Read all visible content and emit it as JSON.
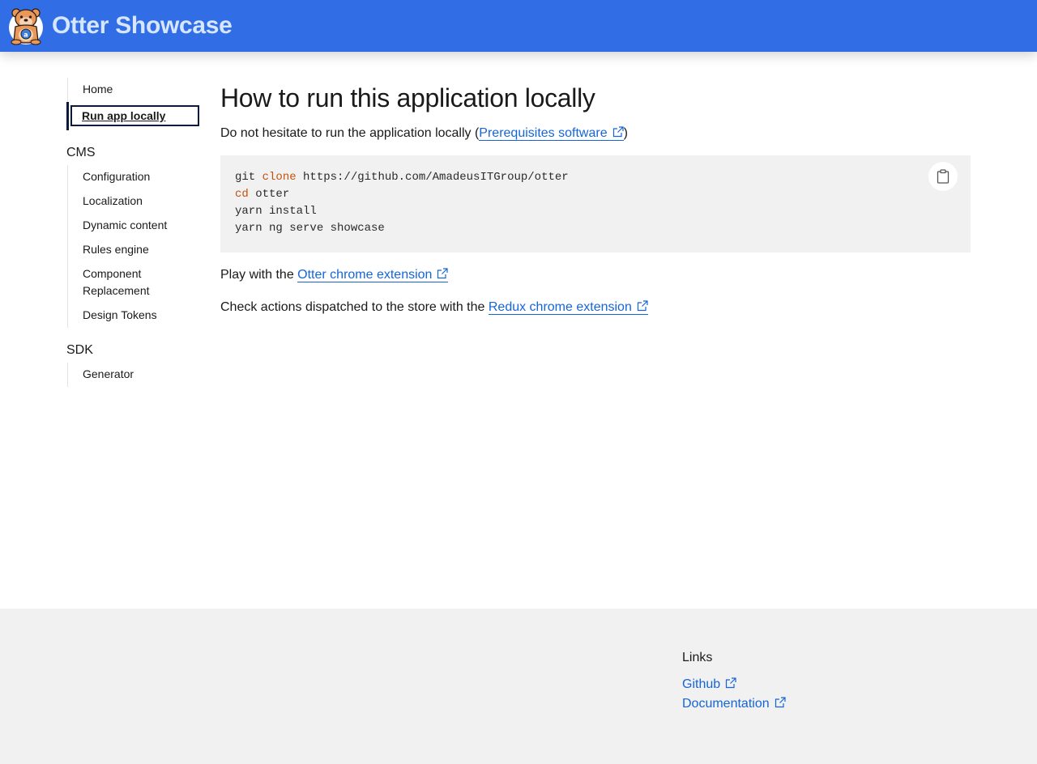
{
  "header": {
    "brand": "Otter Showcase",
    "logo_icon": "otter-logo-icon",
    "color": "#316ee5"
  },
  "sidebar": {
    "top_items": [
      {
        "label": "Home"
      },
      {
        "label": "Run app locally",
        "active": true
      }
    ],
    "cms": {
      "title": "CMS",
      "items": [
        {
          "label": "Configuration"
        },
        {
          "label": "Localization"
        },
        {
          "label": "Dynamic content"
        },
        {
          "label": "Rules engine"
        },
        {
          "label": "Component Replacement"
        },
        {
          "label": "Design Tokens"
        }
      ]
    },
    "sdk": {
      "title": "SDK",
      "items": [
        {
          "label": "Generator"
        }
      ]
    }
  },
  "main": {
    "title": "How to run this application locally",
    "intro": {
      "before": "Do not hesitate to run the application locally (",
      "link": "Prerequisites software",
      "after": ")"
    },
    "code": {
      "lines": [
        {
          "kw_prefix": "git ",
          "kw": "clone",
          "rest": " https://github.com/AmadeusITGroup/otter"
        },
        {
          "kw_prefix": "",
          "kw": "cd",
          "rest": " otter"
        },
        {
          "kw_prefix": "",
          "kw": "",
          "rest": "yarn install"
        },
        {
          "kw_prefix": "",
          "kw": "",
          "rest": "yarn ng serve showcase"
        }
      ],
      "copy_icon": "clipboard-icon"
    },
    "play": {
      "before": "Play with the ",
      "link": "Otter chrome extension"
    },
    "check": {
      "before": "Check actions dispatched to the store with the ",
      "link": "Redux chrome extension"
    }
  },
  "footer": {
    "title": "Links",
    "links": [
      {
        "label": "Github"
      },
      {
        "label": "Documentation"
      }
    ]
  },
  "colors": {
    "link": "#1565d8",
    "code_keyword": "#c4520d",
    "code_bg": "#f1f1f1",
    "footer_bg": "#f1f1f1"
  }
}
